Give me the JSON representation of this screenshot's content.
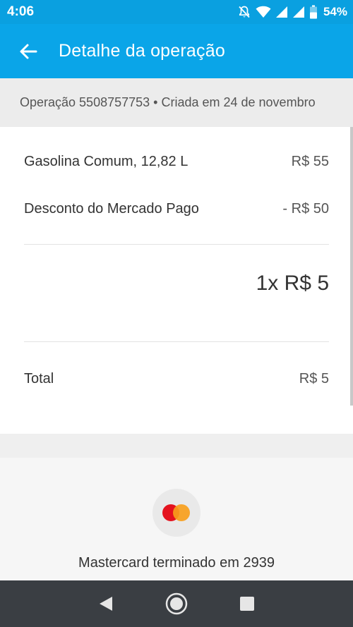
{
  "status_bar": {
    "time": "4:06",
    "battery_percent": "54%",
    "icons": [
      "notifications-off-icon",
      "wifi-icon",
      "signal-icon",
      "signal-icon",
      "battery-icon"
    ]
  },
  "app_bar": {
    "title": "Detalhe da operação",
    "back_icon": "arrow-left-icon"
  },
  "operation": {
    "info": "Operação 5508757753 • Criada em 24 de novembro"
  },
  "items": [
    {
      "label": "Gasolina Comum, 12,82 L",
      "value": "R$ 55"
    },
    {
      "label": "Desconto do Mercado Pago",
      "value": "- R$ 50"
    }
  ],
  "installments": "1x R$ 5",
  "total": {
    "label": "Total",
    "value": "R$ 5"
  },
  "payment": {
    "brand_icon": "mastercard-icon",
    "label": "Mastercard terminado em 2939"
  },
  "nav_bar": {
    "icons": [
      "back-triangle-icon",
      "home-circle-icon",
      "recents-square-icon"
    ]
  },
  "colors": {
    "primary": "#0aa5e8",
    "status_bar": "#0aa0e0",
    "nav_bar": "#3a3e43",
    "mastercard_red": "#e4121e",
    "mastercard_orange": "#f79e1b"
  }
}
